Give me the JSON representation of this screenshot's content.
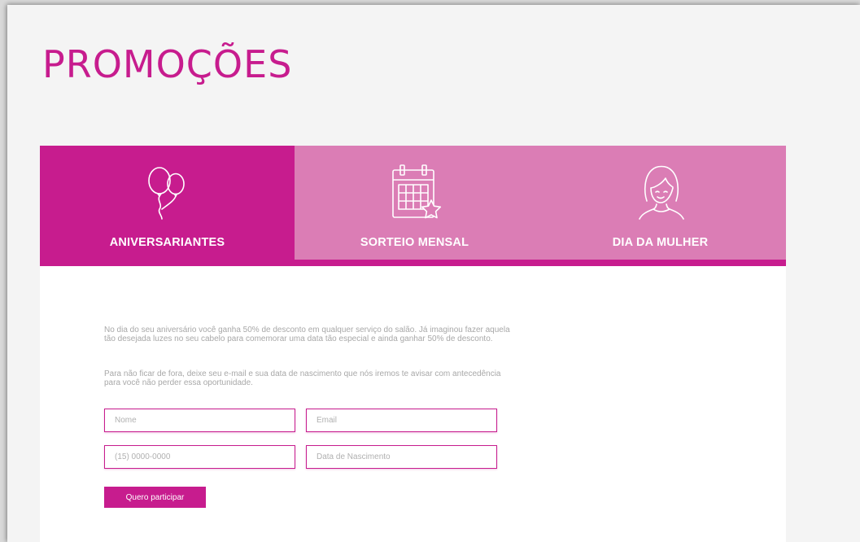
{
  "page": {
    "title": "PROMOÇÕES"
  },
  "tabs": [
    {
      "label": "ANIVERSARIANTES",
      "icon": "balloons-icon",
      "active": true
    },
    {
      "label": "SORTEIO MENSAL",
      "icon": "calendar-star-icon",
      "active": false
    },
    {
      "label": "DIA DA MULHER",
      "icon": "woman-face-icon",
      "active": false
    }
  ],
  "content": {
    "paragraph_1": "No dia do seu aniversário você ganha 50% de desconto em qualquer serviço do salão. Já imaginou fazer aquela tão desejada luzes no seu cabelo para comemorar uma data tão especial e ainda ganhar 50% de desconto.",
    "paragraph_2": "Para não ficar de fora, deixe seu e-mail e sua data de nascimento que nós iremos te avisar com antecedência para você não perder essa oportunidade."
  },
  "form": {
    "name_placeholder": "Nome",
    "email_placeholder": "Email",
    "phone_placeholder": "(15) 0000-0000",
    "birthdate_placeholder": "Data de Nascimento",
    "submit_label": "Quero participar"
  },
  "colors": {
    "accent": "#c71c8e",
    "tab_inactive": "#db7db5",
    "page_background": "#f4f4f4"
  }
}
